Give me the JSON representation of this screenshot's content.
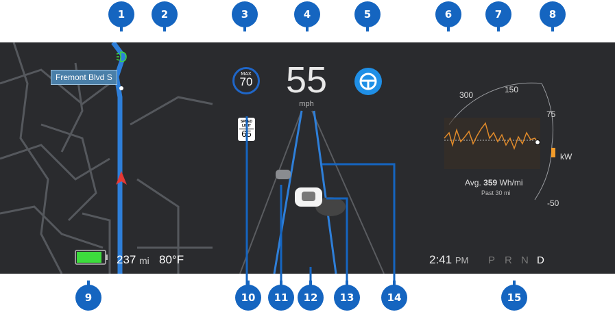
{
  "callouts": [
    "1",
    "2",
    "3",
    "4",
    "5",
    "6",
    "7",
    "8",
    "9",
    "10",
    "11",
    "12",
    "13",
    "14",
    "15"
  ],
  "map": {
    "street_label": "Fremont Blvd S"
  },
  "status": {
    "range_value": "237",
    "range_unit": "mi",
    "temperature": "80°F"
  },
  "speed": {
    "max_label": "MAX",
    "max_value": "70",
    "current": "55",
    "unit": "mph"
  },
  "speed_limit_sign": {
    "label_line1": "SPEED",
    "label_line2": "LIMIT",
    "value": "65"
  },
  "energy": {
    "ticks": [
      "300",
      "150",
      "75",
      "-50"
    ],
    "unit": "kW",
    "avg_prefix": "Avg.",
    "avg_value": "359",
    "avg_unit": "Wh/mi",
    "period": "Past 30 mi"
  },
  "clock": {
    "time": "2:41",
    "ampm": "PM"
  },
  "gears": [
    "P",
    "R",
    "N",
    "D"
  ],
  "active_gear": "D",
  "colors": {
    "route": "#2e7fd9",
    "battery": "#3ddc3d",
    "energy_line": "#e08a2a",
    "nav_arrow": "#e53935",
    "callout": "#1565c0"
  }
}
